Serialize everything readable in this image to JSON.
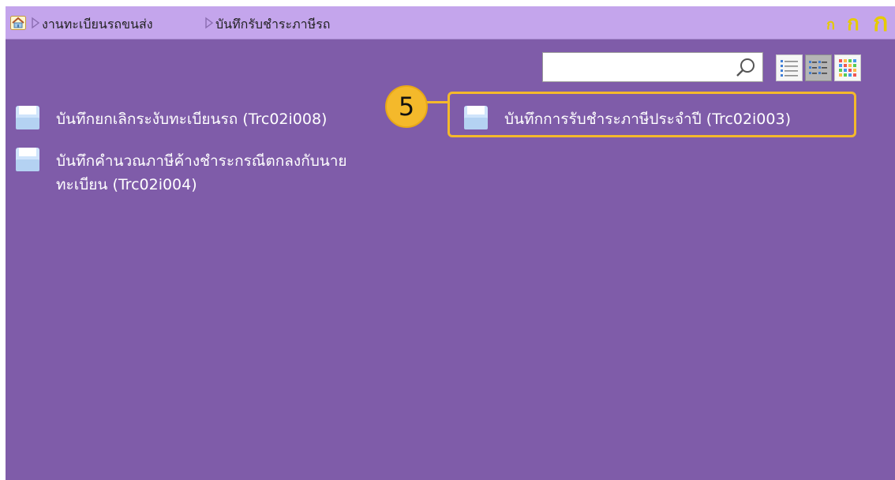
{
  "breadcrumb": {
    "home_icon": "home-icon",
    "items": [
      "งานทะเบียนรถขนส่ง",
      "บันทึกรับชำระภาษีรถ"
    ]
  },
  "font_size_controls": [
    "ก",
    "ก",
    "ก"
  ],
  "search": {
    "value": "",
    "icon": "magnifier-icon"
  },
  "view_modes": [
    "list-view",
    "detail-view",
    "tile-view"
  ],
  "menu_items": [
    {
      "label": "บันทึกยกเลิกระงับทะเบียนรถ (Trc02i008)",
      "icon": "floppy-disk-icon"
    },
    {
      "label": "บันทึกการรับชำระภาษีประจำปี (Trc02i003)",
      "icon": "floppy-disk-icon",
      "highlighted": true
    },
    {
      "label_line1": "บันทึกคำนวณภาษีค้างชำระกรณีตกลงกับนาย",
      "label_line2": "ทะเบียน (Trc02i004)",
      "icon": "floppy-disk-icon"
    }
  ],
  "annotation": {
    "step_number": "5",
    "color": "#f4b92b"
  },
  "colors": {
    "background": "#7f5ca9",
    "topbar": "#c4a5ec",
    "accent": "#e6cb00",
    "menu_text": "#ffffff"
  }
}
